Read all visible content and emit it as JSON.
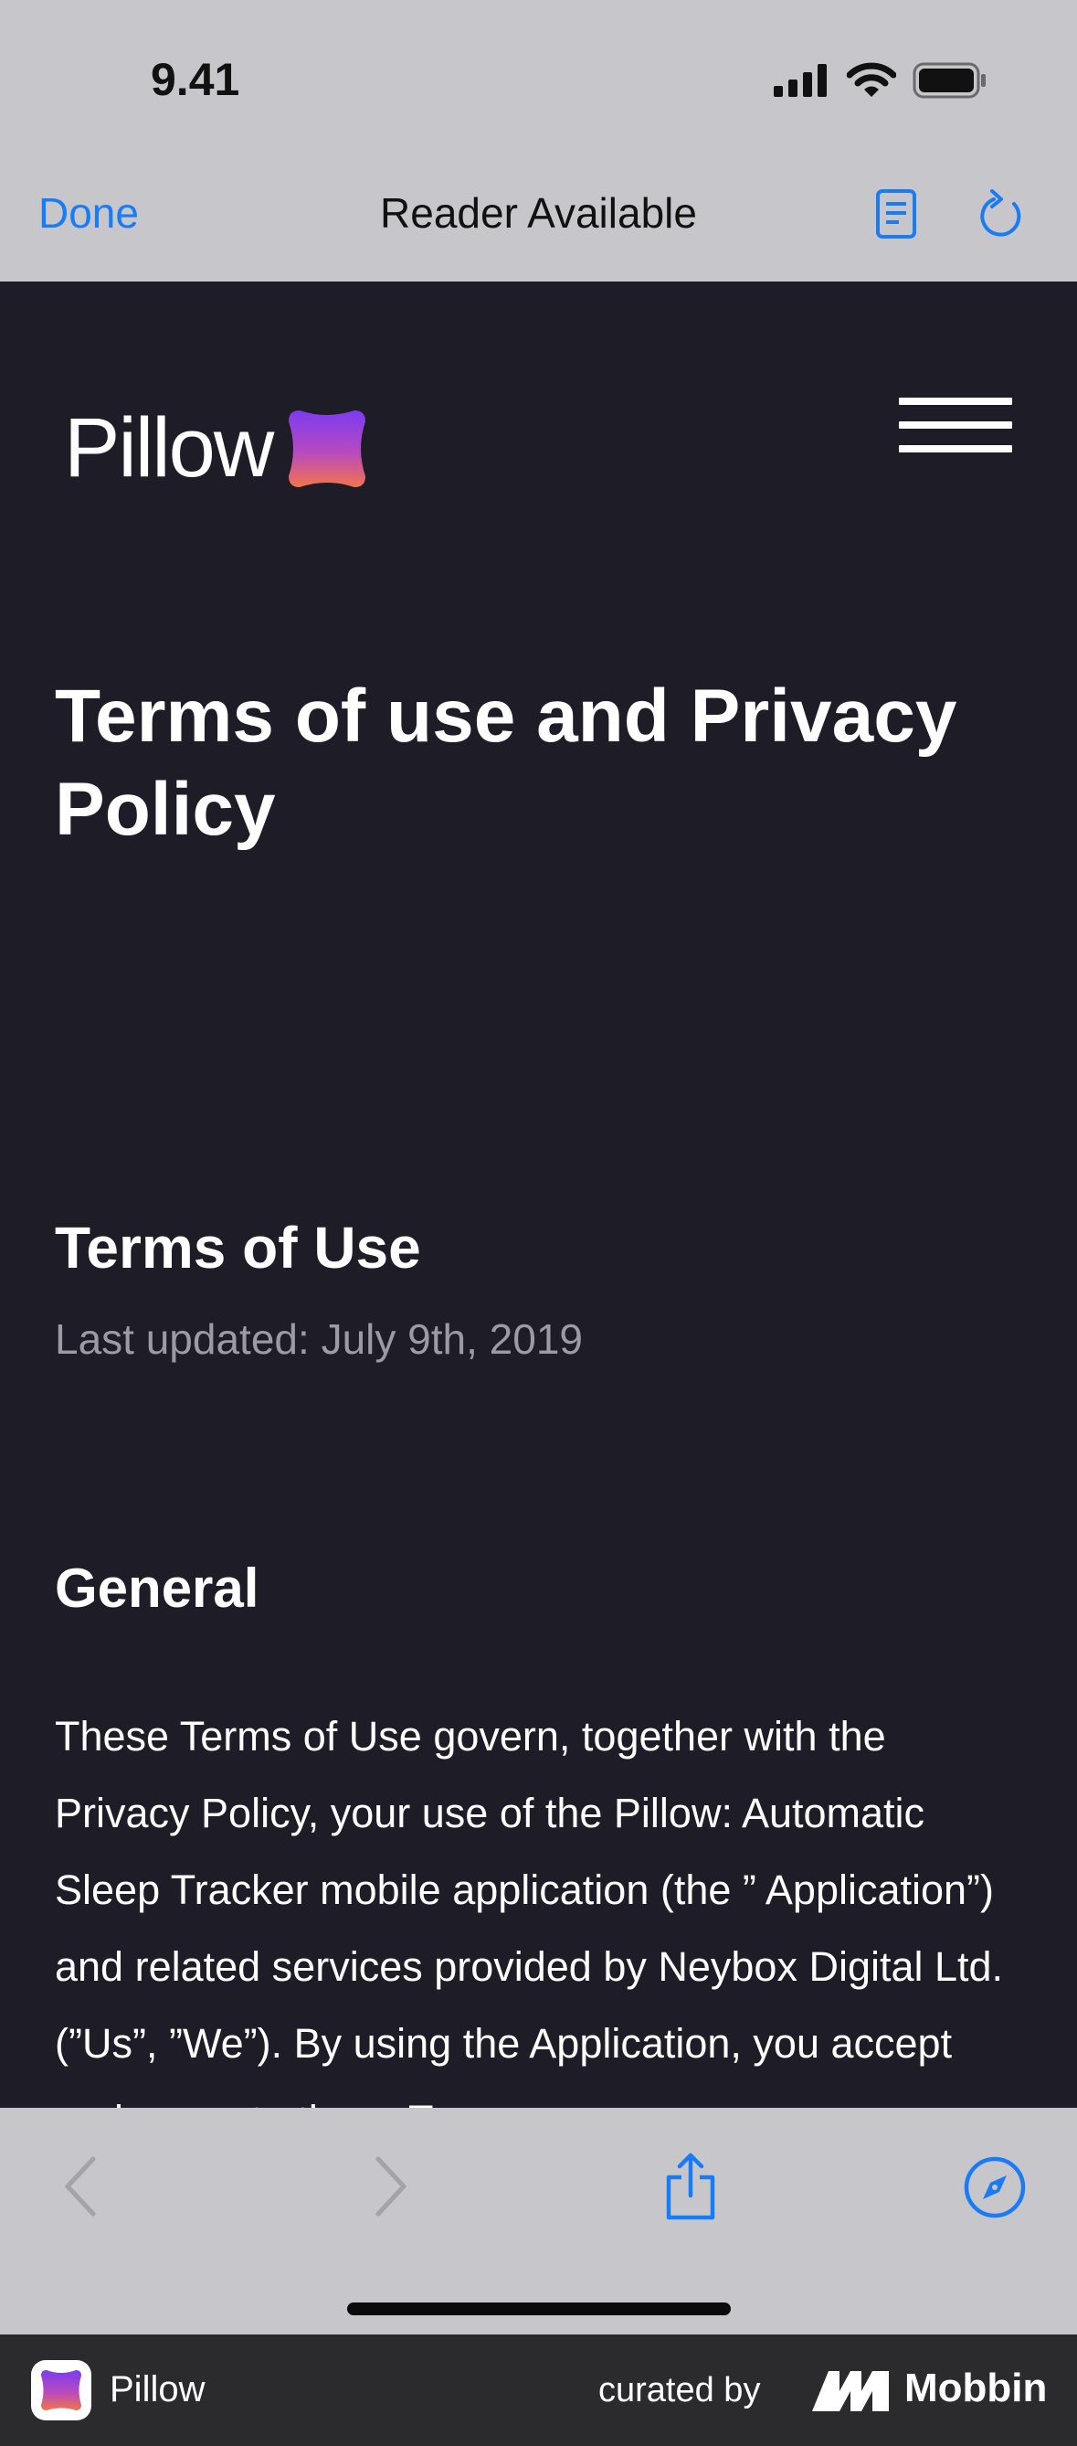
{
  "status_bar": {
    "time": "9.41"
  },
  "browser": {
    "done_label": "Done",
    "title": "Reader Available",
    "reader_icon": "reader-icon",
    "reload_icon": "reload-icon"
  },
  "page": {
    "logo_text": "Pillow",
    "heading": "Terms of use and Privacy Policy",
    "section_title": "Terms of Use",
    "last_updated": "Last updated: July 9th, 2019",
    "subsection_title": "General",
    "body": "These Terms of Use govern, together with the Privacy Policy, your use of the Pillow: Automatic Sleep Tracker mobile application (the ” Application”) and related services provided by Neybox Digital Ltd. (”Us”, ”We”). By using the Application, you accept and agree to these Terms"
  },
  "toolbar": {
    "back_icon": "chevron-left-icon",
    "forward_icon": "chevron-right-icon",
    "share_icon": "share-icon",
    "compass_icon": "compass-icon"
  },
  "footer": {
    "app_name": "Pillow",
    "curated_by": "curated by",
    "brand": "Mobbin"
  },
  "colors": {
    "accent": "#1a7cf5",
    "page_background": "#1e1d27",
    "browser_chrome": "#c7c7cb",
    "footer_background": "#2b2b2d"
  }
}
